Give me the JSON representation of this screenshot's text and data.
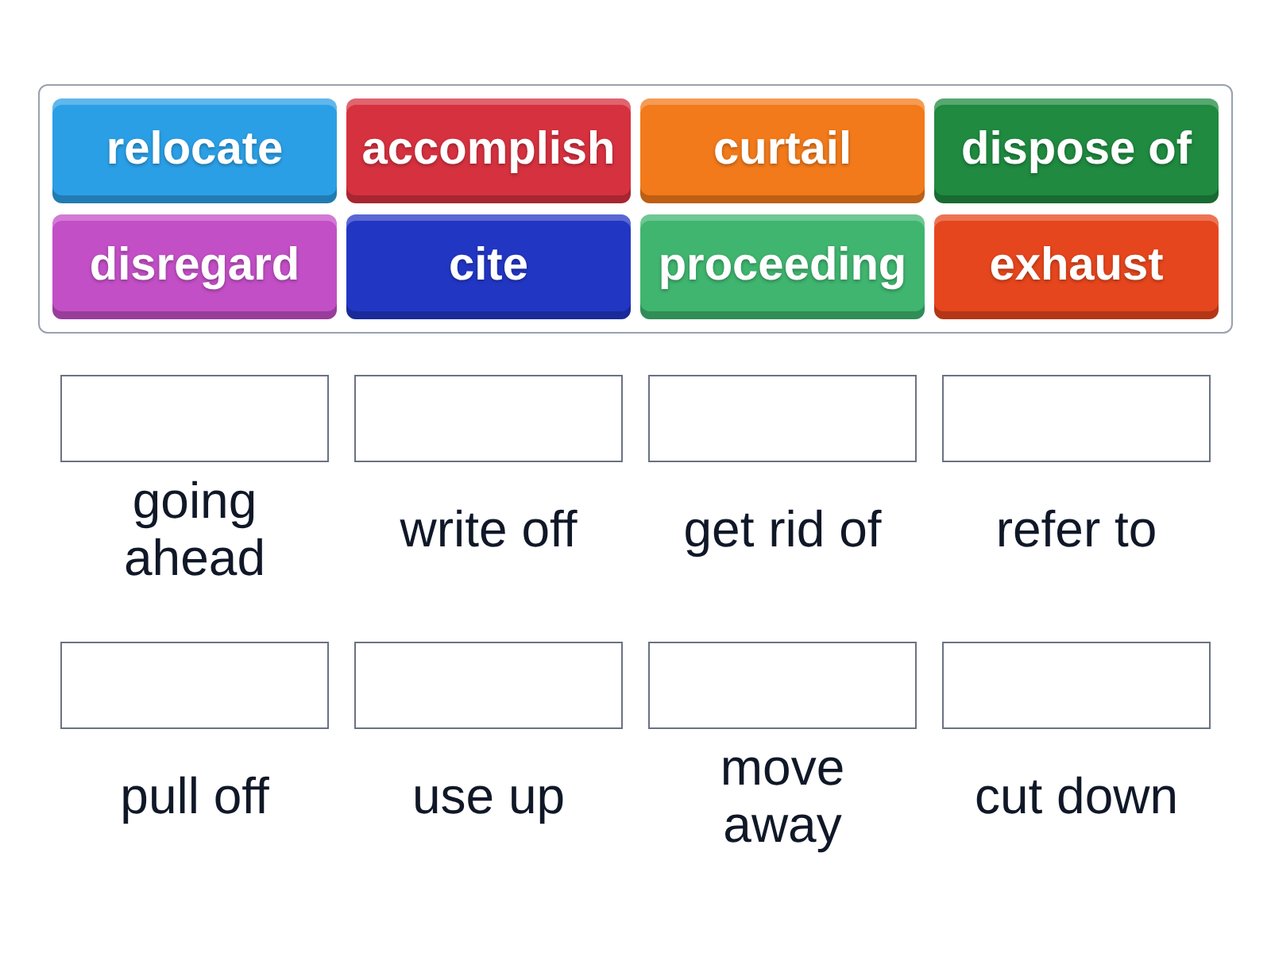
{
  "tiles": [
    {
      "label": "relocate",
      "color": "#2b9fe6"
    },
    {
      "label": "accomplish",
      "color": "#d6313f"
    },
    {
      "label": "curtail",
      "color": "#f27a1a"
    },
    {
      "label": "dispose of",
      "color": "#1f8a40"
    },
    {
      "label": "disregard",
      "color": "#c34fc6"
    },
    {
      "label": "cite",
      "color": "#2236c4"
    },
    {
      "label": "proceeding",
      "color": "#3fb56f"
    },
    {
      "label": "exhaust",
      "color": "#e6461d"
    }
  ],
  "targets": [
    {
      "label": "going ahead"
    },
    {
      "label": "write off"
    },
    {
      "label": "get rid of"
    },
    {
      "label": "refer to"
    },
    {
      "label": "pull off"
    },
    {
      "label": "use up"
    },
    {
      "label": "move away"
    },
    {
      "label": "cut down"
    }
  ]
}
